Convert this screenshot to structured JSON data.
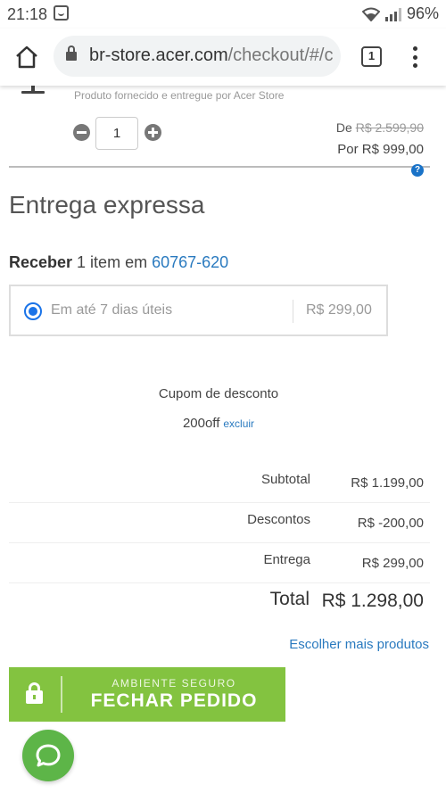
{
  "status_bar": {
    "time": "21:18",
    "battery": "96%",
    "icons": [
      "app-notification-icon",
      "wifi-icon",
      "signal-icon"
    ]
  },
  "browser": {
    "url_domain": "br-store.acer.com",
    "url_path": "/checkout/#/c",
    "tab_count": "1",
    "icons": [
      "home-icon",
      "lock-icon",
      "more-vert-icon"
    ]
  },
  "product": {
    "seller": "Produto fornecido e entregue por Acer Store",
    "quantity": "1",
    "price_from_label": "De",
    "price_from_value": "R$ 2.599,90",
    "price_to": "Por R$ 999,00"
  },
  "delivery": {
    "title": "Entrega expressa",
    "receive_label": "Receber",
    "receive_items": " 1 item em ",
    "postal_code": "60767-620",
    "option_label": "Em até 7 dias úteis",
    "option_price": "R$ 299,00",
    "option_selected": true
  },
  "coupon": {
    "title": "Cupom de desconto",
    "code": "200off",
    "remove_label": "excluir"
  },
  "totals": {
    "rows": [
      {
        "label": "Subtotal",
        "value": "R$ 1.199,00"
      },
      {
        "label": "Descontos",
        "value": "R$ -200,00"
      },
      {
        "label": "Entrega",
        "value": "R$ 299,00"
      }
    ],
    "grand_label": "Total",
    "grand_value": "R$ 1.298,00"
  },
  "links": {
    "more_products": "Escolher mais produtos"
  },
  "checkout": {
    "secure_label": "AMBIENTE SEGURO",
    "button_label": "FECHAR PEDIDO"
  },
  "colors": {
    "accent_blue": "#2a7abf",
    "checkout_green": "#83c340",
    "chat_green": "#5db548"
  }
}
